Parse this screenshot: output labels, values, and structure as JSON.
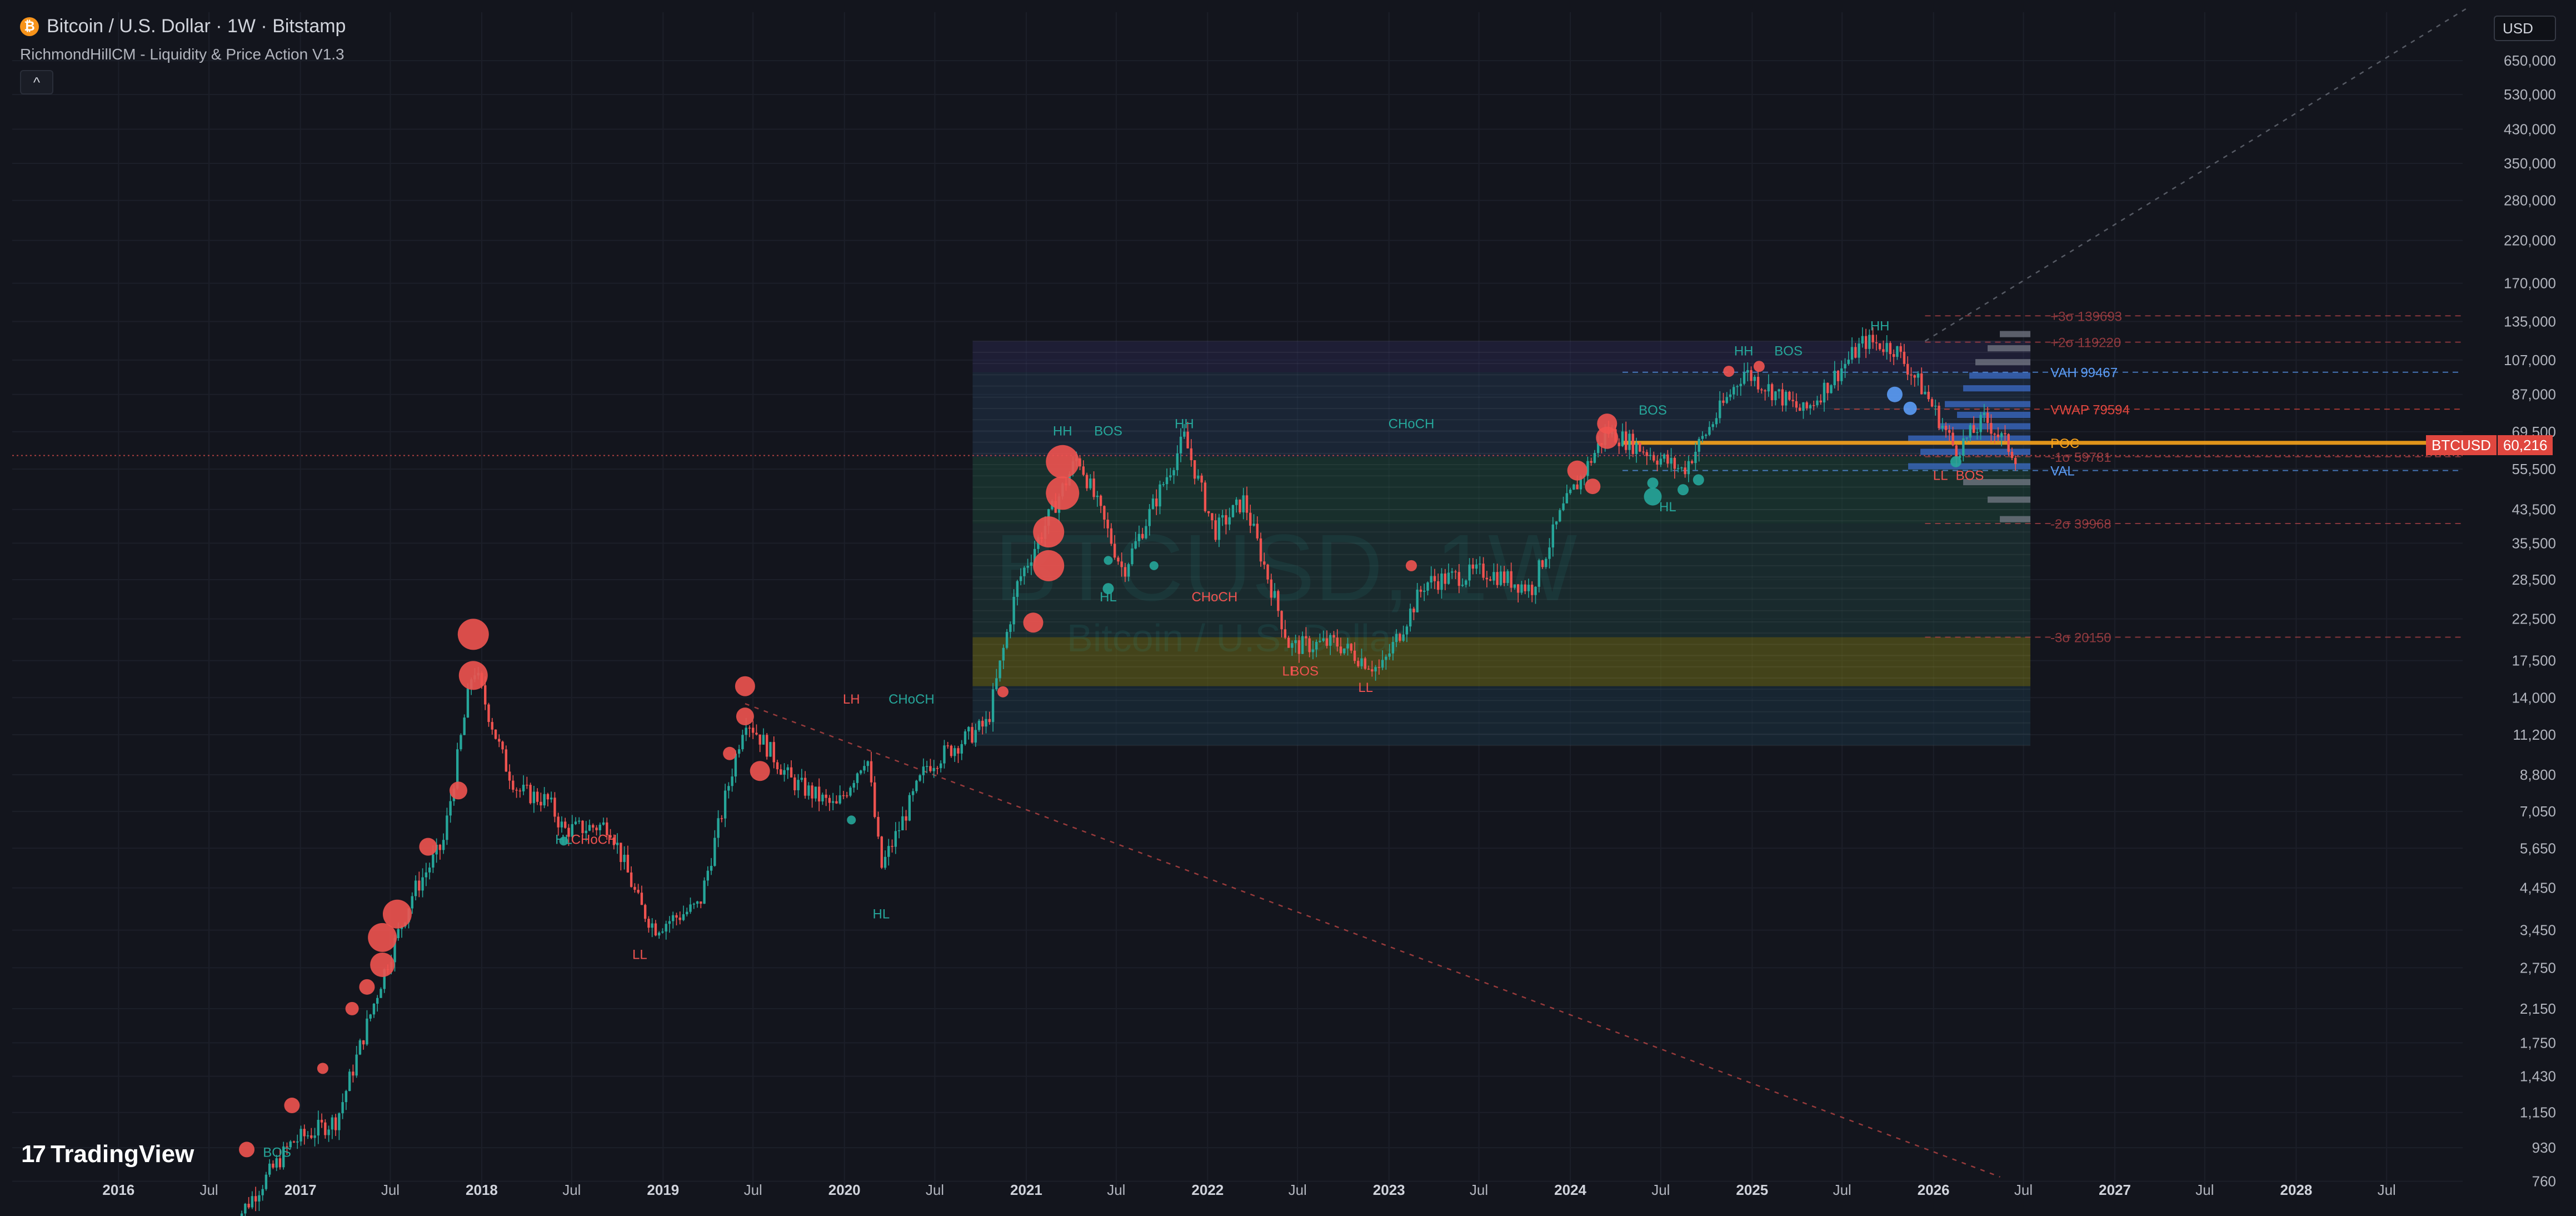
{
  "header": {
    "symbol_title": "Bitcoin / U.S. Dollar · 1W · Bitstamp",
    "indicator_name": "RichmondHillCM - Liquidity & Price Action V1.3",
    "collapse_glyph": "^",
    "currency": "USD",
    "btc_icon": "bitcoin-icon"
  },
  "watermark": {
    "symbol": "BTCUSD, 1W",
    "name": "Bitcoin / U.S. Dollar"
  },
  "brand": {
    "name": "TradingView",
    "mark": "17"
  },
  "price_tag": {
    "symbol": "BTCUSD",
    "price": "60,216"
  },
  "colors": {
    "bull": "#26a69a",
    "bear": "#ef5350",
    "poc": "#f7a21b",
    "vah_val": "#5b9cf6",
    "vwap": "#e0473f",
    "background": "#13151d"
  },
  "chart_data": {
    "type": "candlestick",
    "title": "Bitcoin / U.S. Dollar · 1W · Bitstamp",
    "yscale": "log",
    "ylim": [
      700,
      870000
    ],
    "xlim": [
      "2015-06",
      "2028-12"
    ],
    "yticks": [
      "650,000",
      "530,000",
      "430,000",
      "350,000",
      "280,000",
      "220,000",
      "170,000",
      "135,000",
      "107,000",
      "87,000",
      "69,500",
      "55,500",
      "43,500",
      "35,500",
      "28,500",
      "22,500",
      "17,500",
      "14,000",
      "11,200",
      "8,800",
      "7,050",
      "5,650",
      "4,450",
      "3,450",
      "2,750",
      "2,150",
      "1,750",
      "1,430",
      "1,150",
      "930",
      "760"
    ],
    "xticks": [
      "2016",
      "Jul",
      "2017",
      "Jul",
      "2018",
      "Jul",
      "2019",
      "Jul",
      "2020",
      "Jul",
      "2021",
      "Jul",
      "2022",
      "Jul",
      "2023",
      "Jul",
      "2024",
      "Jul",
      "2025",
      "Jul",
      "2026",
      "Jul",
      "2027",
      "Jul",
      "2028",
      "Jul"
    ],
    "price_path": [
      [
        "2016-08",
        580
      ],
      [
        "2016-12",
        960
      ],
      [
        "2017-03",
        1100
      ],
      [
        "2017-06",
        2600
      ],
      [
        "2017-08",
        4300
      ],
      [
        "2017-10",
        5800
      ],
      [
        "2017-12",
        17000
      ],
      [
        "2018-02",
        9500
      ],
      [
        "2018-03",
        8000
      ],
      [
        "2018-05",
        7500
      ],
      [
        "2018-06",
        6300
      ],
      [
        "2018-09",
        6500
      ],
      [
        "2018-11",
        4000
      ],
      [
        "2018-12",
        3500
      ],
      [
        "2019-03",
        4000
      ],
      [
        "2019-06",
        12500
      ],
      [
        "2019-09",
        8500
      ],
      [
        "2019-12",
        7200
      ],
      [
        "2020-02",
        10000
      ],
      [
        "2020-03",
        5000
      ],
      [
        "2020-06",
        9300
      ],
      [
        "2020-10",
        12000
      ],
      [
        "2020-12",
        28000
      ],
      [
        "2021-04",
        60000
      ],
      [
        "2021-07",
        30000
      ],
      [
        "2021-11",
        67000
      ],
      [
        "2022-01",
        38000
      ],
      [
        "2022-03",
        46000
      ],
      [
        "2022-06",
        19000
      ],
      [
        "2022-09",
        19500
      ],
      [
        "2022-12",
        16500
      ],
      [
        "2023-03",
        28000
      ],
      [
        "2023-07",
        30000
      ],
      [
        "2023-10",
        27000
      ],
      [
        "2023-12",
        43000
      ],
      [
        "2024-03",
        70000
      ],
      [
        "2024-08",
        55000
      ],
      [
        "2024-12",
        100000
      ],
      [
        "2025-04",
        78000
      ],
      [
        "2025-08",
        120000
      ],
      [
        "2025-10",
        115000
      ],
      [
        "2025-12",
        88000
      ],
      [
        "2026-02",
        62000
      ],
      [
        "2026-04",
        75000
      ],
      [
        "2026-06",
        60216
      ]
    ],
    "structure_labels": [
      {
        "text": "BOS",
        "x": "2016-11",
        "y": 880,
        "side": "bull"
      },
      {
        "text": "HL",
        "x": "2018-06",
        "y": 5800,
        "side": "bull"
      },
      {
        "text": "CHoCH",
        "x": "2018-08",
        "y": 5800,
        "side": "bear"
      },
      {
        "text": "LL",
        "x": "2018-11",
        "y": 2900,
        "side": "bear"
      },
      {
        "text": "LH",
        "x": "2020-01",
        "y": 13500,
        "side": "bear"
      },
      {
        "text": "CHoCH",
        "x": "2020-05",
        "y": 13500,
        "side": "bull"
      },
      {
        "text": "HL",
        "x": "2020-03",
        "y": 3700,
        "side": "bull"
      },
      {
        "text": "HH",
        "x": "2021-03",
        "y": 68000,
        "side": "bull"
      },
      {
        "text": "BOS",
        "x": "2021-06",
        "y": 68000,
        "side": "bull"
      },
      {
        "text": "HH",
        "x": "2021-11",
        "y": 71000,
        "side": "bull"
      },
      {
        "text": "HL",
        "x": "2021-06",
        "y": 25000,
        "side": "bull"
      },
      {
        "text": "CHoCH",
        "x": "2022-01",
        "y": 25000,
        "side": "bear"
      },
      {
        "text": "CHoCH",
        "x": "2023-02",
        "y": 71000,
        "side": "bull"
      },
      {
        "text": "LL",
        "x": "2022-06",
        "y": 16000,
        "side": "bear"
      },
      {
        "text": "BOS",
        "x": "2022-07",
        "y": 16000,
        "side": "bear"
      },
      {
        "text": "LL",
        "x": "2022-11",
        "y": 14500,
        "side": "bear"
      },
      {
        "text": "BOS",
        "x": "2024-06",
        "y": 77000,
        "side": "bull"
      },
      {
        "text": "HL",
        "x": "2024-07",
        "y": 43000,
        "side": "bull"
      },
      {
        "text": "HH",
        "x": "2024-12",
        "y": 110000,
        "side": "bull"
      },
      {
        "text": "BOS",
        "x": "2025-03",
        "y": 110000,
        "side": "bull"
      },
      {
        "text": "HH",
        "x": "2025-09",
        "y": 128000,
        "side": "bull"
      },
      {
        "text": "LL",
        "x": "2026-01",
        "y": 52000,
        "side": "bear"
      },
      {
        "text": "BOS",
        "x": "2026-03",
        "y": 52000,
        "side": "bear"
      }
    ],
    "levels": [
      {
        "label": "+3σ 139693",
        "value": 139693,
        "kind": "sigma"
      },
      {
        "label": "+2σ 119220",
        "value": 119220,
        "kind": "sigma"
      },
      {
        "label": "VAH 99467",
        "value": 99467,
        "kind": "vah"
      },
      {
        "label": "VWAP 79594",
        "value": 79594,
        "kind": "vwap"
      },
      {
        "label": "POC",
        "value": 65000,
        "kind": "poc"
      },
      {
        "label": "-1σ 59781",
        "value": 59781,
        "kind": "sigma"
      },
      {
        "label": "VAL",
        "value": 55000,
        "kind": "val"
      },
      {
        "label": "-2σ 39968",
        "value": 39968,
        "kind": "sigma"
      },
      {
        "label": "-3σ 20150",
        "value": 20150,
        "kind": "sigma"
      }
    ],
    "liquidity_zone": {
      "from": "2020-09",
      "to": "2026-07",
      "low": 10500,
      "high": 120000
    },
    "last_price": 60216
  }
}
